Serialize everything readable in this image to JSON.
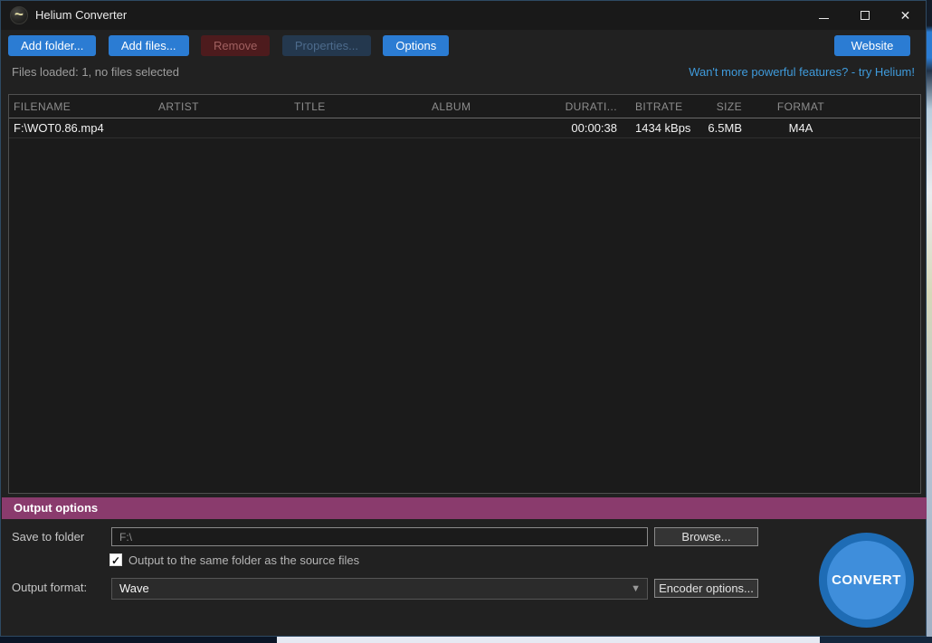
{
  "window": {
    "title": "Helium Converter"
  },
  "icons": {
    "app_logo": "~",
    "close": "✕",
    "caret_down": "▼",
    "check": "✓"
  },
  "toolbar": {
    "add_folder": "Add folder...",
    "add_files": "Add files...",
    "remove": "Remove",
    "properties": "Properties...",
    "options": "Options",
    "website": "Website"
  },
  "status": {
    "files_loaded": "Files loaded: 1, no files selected",
    "promo_link": "Wan't more powerful features? - try Helium!"
  },
  "table": {
    "columns": [
      "FILENAME",
      "ARTIST",
      "TITLE",
      "ALBUM",
      "DURATI...",
      "BITRATE",
      "SIZE",
      "FORMAT"
    ],
    "rows": [
      {
        "filename": "F:\\WOT0.86.mp4",
        "artist": "",
        "title": "",
        "album": "",
        "duration": "00:00:38",
        "bitrate": "1434 kBps",
        "size": "6.5MB",
        "format": "M4A"
      }
    ]
  },
  "output_options": {
    "header": "Output options",
    "save_to_folder_label": "Save to folder",
    "folder_value": "F:\\",
    "browse_label": "Browse...",
    "same_folder_checkbox_label": "Output to the same folder as the source files",
    "same_folder_checked": true,
    "output_format_label": "Output format:",
    "format_value": "Wave",
    "encoder_options_label": "Encoder options...",
    "convert_label": "CONVERT"
  },
  "colors": {
    "accent_blue": "#2b7cd3",
    "link_blue": "#3f9bdc",
    "output_band_purple": "#8a3b6d",
    "convert_outer": "#1e6cb5",
    "convert_inner": "#3f8edb",
    "disabled_remove_bg": "#4d1b1d",
    "disabled_properties_bg": "#24384e",
    "window_bg": "#212121"
  }
}
